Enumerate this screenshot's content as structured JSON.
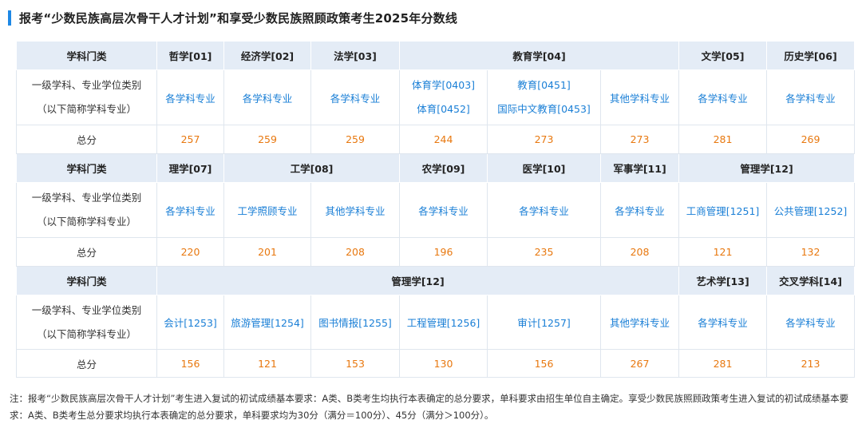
{
  "title": "报考“少数民族高层次骨干人才计划”和享受少数民族照顾政策考生2025年分数线",
  "row_labels": {
    "category": "学科门类",
    "level_line1": "一级学科、专业学位类别",
    "level_line2": "（以下简称学科专业）",
    "total": "总分"
  },
  "block1": {
    "headers": [
      "哲学[01]",
      "经济学[02]",
      "法学[03]",
      "教育学[04]",
      "文学[05]",
      "历史学[06]"
    ],
    "majors": [
      [
        "各学科专业"
      ],
      [
        "各学科专业"
      ],
      [
        "各学科专业"
      ],
      [
        "体育学[0403]",
        "体育[0452]"
      ],
      [
        "教育[0451]",
        "国际中文教育[0453]"
      ],
      [
        "其他学科专业"
      ],
      [
        "各学科专业"
      ],
      [
        "各学科专业"
      ]
    ],
    "totals": [
      "257",
      "259",
      "259",
      "244",
      "273",
      "273",
      "281",
      "269"
    ]
  },
  "block2": {
    "headers": [
      "理学[07]",
      "工学[08]",
      "农学[09]",
      "医学[10]",
      "军事学[11]",
      "管理学[12]"
    ],
    "majors": [
      [
        "各学科专业"
      ],
      [
        "工学照顾专业"
      ],
      [
        "其他学科专业"
      ],
      [
        "各学科专业"
      ],
      [
        "各学科专业"
      ],
      [
        "各学科专业"
      ],
      [
        "工商管理[1251]"
      ],
      [
        "公共管理[1252]"
      ]
    ],
    "totals": [
      "220",
      "201",
      "208",
      "196",
      "235",
      "208",
      "121",
      "132"
    ]
  },
  "block3": {
    "headers": [
      "管理学[12]",
      "艺术学[13]",
      "交叉学科[14]"
    ],
    "majors": [
      [
        "会计[1253]"
      ],
      [
        "旅游管理[1254]"
      ],
      [
        "图书情报[1255]"
      ],
      [
        "工程管理[1256]"
      ],
      [
        "审计[1257]"
      ],
      [
        "其他学科专业"
      ],
      [
        "各学科专业"
      ],
      [
        "各学科专业"
      ]
    ],
    "totals": [
      "156",
      "121",
      "153",
      "130",
      "156",
      "267",
      "281",
      "213"
    ]
  },
  "note": "注：报考“少数民族高层次骨干人才计划”考生进入复试的初试成绩基本要求：A类、B类考生均执行本表确定的总分要求，单科要求由招生单位自主确定。享受少数民族照顾政策考生进入复试的初试成绩基本要求：A类、B类考生总分要求均执行本表确定的总分要求，单科要求均为30分（满分＝100分）、45分（满分＞100分）。",
  "colors": {
    "accent": "#1e88e5",
    "link": "#1a7fd6",
    "score": "#e8780f",
    "header_bg": "#e4ecf6"
  }
}
